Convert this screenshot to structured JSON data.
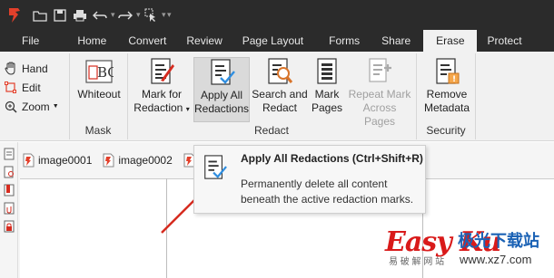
{
  "tabs": [
    {
      "label": "File"
    },
    {
      "label": "Home"
    },
    {
      "label": "Convert"
    },
    {
      "label": "Review"
    },
    {
      "label": "Page Layout"
    },
    {
      "label": "Forms"
    },
    {
      "label": "Share"
    },
    {
      "label": "Erase",
      "active": true
    },
    {
      "label": "Protect"
    }
  ],
  "view_tools": {
    "hand": "Hand",
    "edit": "Edit",
    "zoom": "Zoom"
  },
  "ribbon": {
    "mask": {
      "group_label": "Mask",
      "whiteout_label": "Whiteout"
    },
    "redact": {
      "group_label": "Redact",
      "mark_line1": "Mark for",
      "mark_line2": "Redaction",
      "apply_line1": "Apply All",
      "apply_line2": "Redactions",
      "search_line1": "Search and",
      "search_line2": "Redact",
      "mark_pages_line1": "Mark",
      "mark_pages_line2": "Pages",
      "repeat_line1": "Repeat Mark",
      "repeat_line2": "Across Pages"
    },
    "security": {
      "group_label": "Security",
      "remove_line1": "Remove",
      "remove_line2": "Metadata"
    }
  },
  "documents": [
    "image0001",
    "image0002"
  ],
  "tooltip": {
    "title": "Apply All Redactions (Ctrl+Shift+R)",
    "body": "Permanently delete all content beneath the active redaction marks."
  },
  "watermark": {
    "brand": "Easy Ku",
    "cn": "极光下载站",
    "sub": "易 破 解 网 站",
    "url": "www.xz7.com"
  },
  "colors": {
    "titlebar": "#2b2b2b",
    "ribbon_bg": "#f1f1f1",
    "accent_red": "#d62b1f",
    "check_blue": "#2f8ee0"
  }
}
